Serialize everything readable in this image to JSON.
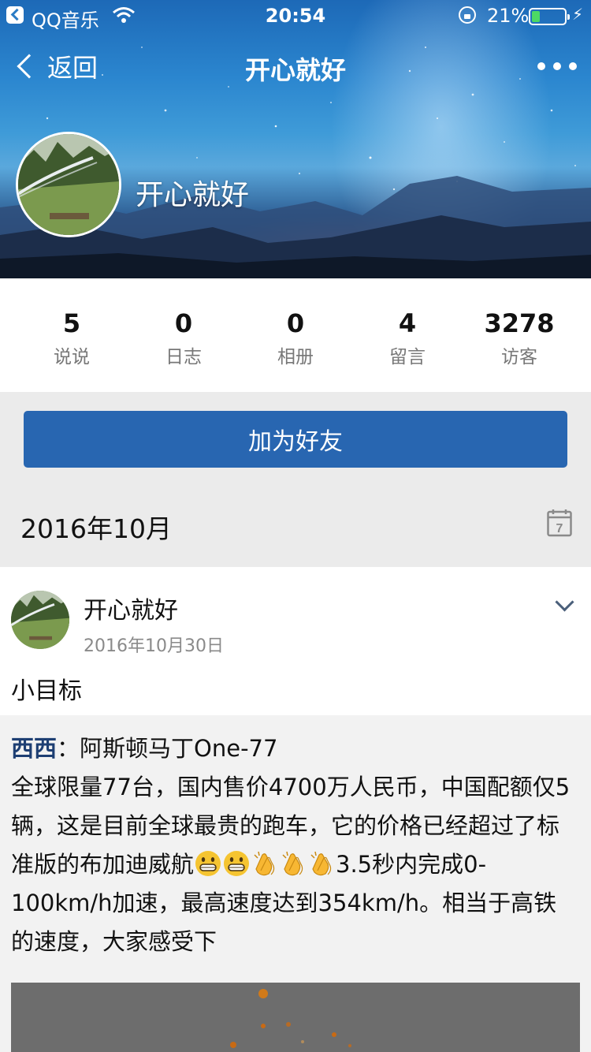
{
  "status_bar": {
    "back_app": "QQ音乐",
    "time": "20:54",
    "battery_percent": "21%",
    "battery_level": 0.21
  },
  "nav": {
    "back_label": "返回",
    "title": "开心就好"
  },
  "profile": {
    "name": "开心就好"
  },
  "stats": [
    {
      "value": "5",
      "label": "说说"
    },
    {
      "value": "0",
      "label": "日志"
    },
    {
      "value": "0",
      "label": "相册"
    },
    {
      "value": "4",
      "label": "留言"
    },
    {
      "value": "3278",
      "label": "访客"
    }
  ],
  "add_friend_label": "加为好友",
  "month_label": "2016年10月",
  "calendar_day": "7",
  "post": {
    "author": "开心就好",
    "date": "2016年10月30日",
    "text": "小目标",
    "shared": {
      "user": "西西",
      "separator": "：",
      "title": "阿斯顿马丁One-77",
      "body_part1": "全球限量77台，国内售价4700万人民币，中国配额仅5辆，这是目前全球最贵的跑车，它的价格已经超过了标准版的布加迪威航",
      "body_part2": "3.5秒内完成0-100km/h加速，最高速度达到354km/h。相当于高铁的速度，大家感受下",
      "emojis": [
        "grinning-face",
        "grinning-face",
        "clapping-hands",
        "clapping-hands",
        "clapping-hands"
      ]
    }
  },
  "colors": {
    "primary_button": "#2866b1",
    "shared_user": "#1e3f73",
    "background": "#ebebeb"
  }
}
